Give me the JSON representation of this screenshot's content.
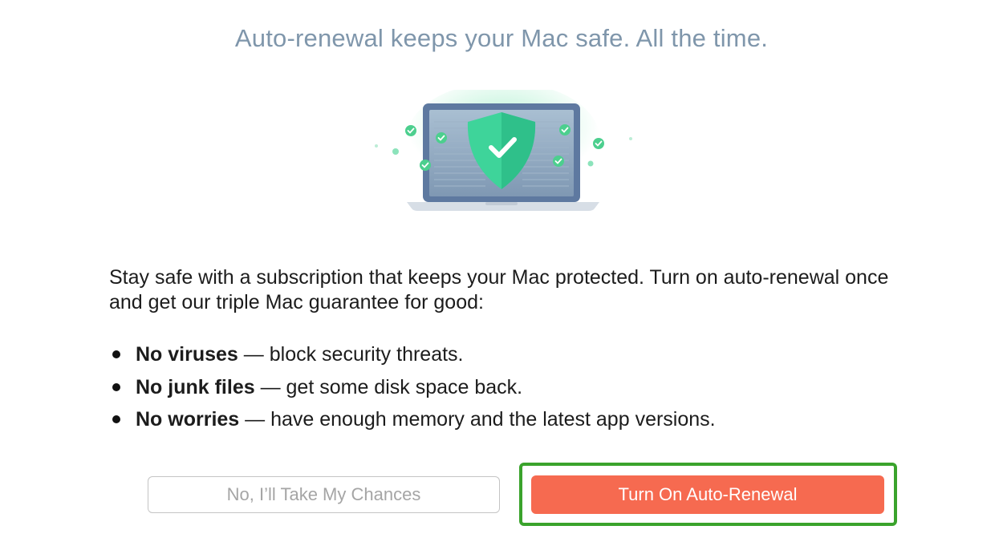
{
  "headline": "Auto-renewal keeps your Mac safe. All the time.",
  "illustration": {
    "icon": "laptop-shield-check-icon",
    "colors": {
      "laptop_frame": "#5e79a0",
      "screen": "#8ea7c0",
      "shield": "#3ed49a",
      "check_dots": "#4ccf8e",
      "base": "#d7dee6"
    }
  },
  "description": "Stay safe with a subscription that keeps your Mac protected. Turn on auto-renewal once and get our triple Mac guarantee for good:",
  "guarantees": [
    {
      "title": "No viruses",
      "text": " — block security threats."
    },
    {
      "title": "No junk files",
      "text": " — get some disk space back."
    },
    {
      "title": "No worries",
      "text": " — have enough memory and the latest app versions."
    }
  ],
  "buttons": {
    "decline_label": "No, I’ll Take My Chances",
    "accept_label": "Turn On Auto-Renewal"
  },
  "colors": {
    "headline": "#7f96ab",
    "accept_button": "#f66a50",
    "highlight_frame": "#3aa32c"
  }
}
